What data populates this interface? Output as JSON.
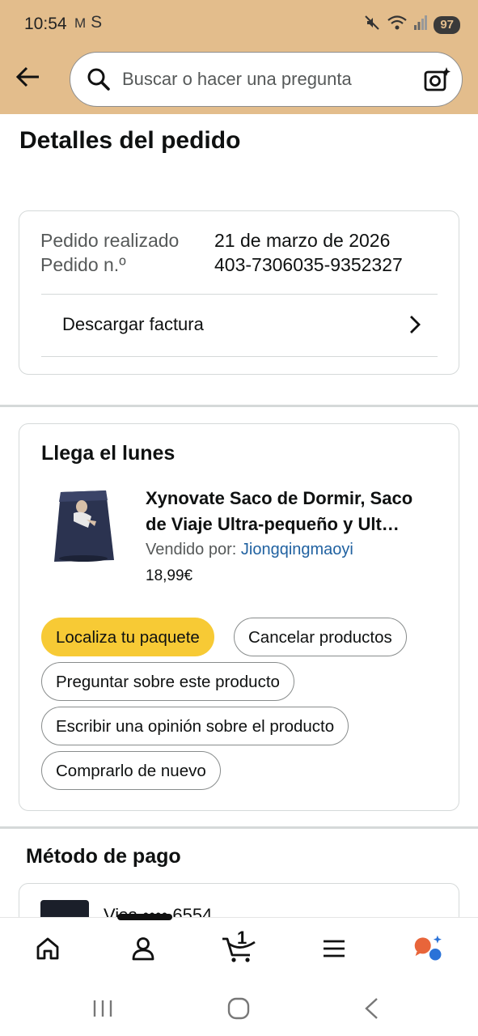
{
  "status_bar": {
    "time": "10:54",
    "notif_icons": [
      "M",
      "S"
    ],
    "battery": "97"
  },
  "search": {
    "placeholder": "Buscar o hacer una pregunta"
  },
  "page": {
    "title": "Detalles del pedido"
  },
  "order_info": {
    "placed_label": "Pedido realizado",
    "placed_value": "21 de marzo de 2026",
    "number_label": "Pedido n.º",
    "number_value": "403-7306035-9352327",
    "invoice_label": "Descargar factura"
  },
  "shipment": {
    "heading": "Llega el lunes",
    "product_title_line1": "Xynovate Saco de Dormir, Saco",
    "product_title_line2": "de Viaje Ultra-pequeño y Ult…",
    "sold_by_label": "Vendido por:",
    "seller": "Jiongqingmaoyi",
    "price": "18,99€",
    "buttons": {
      "track": "Localiza tu paquete",
      "cancel": "Cancelar productos",
      "ask": "Preguntar sobre este producto",
      "review": "Escribir una opinión sobre el producto",
      "buy_again": "Comprarlo de nuevo"
    }
  },
  "payment": {
    "heading": "Método de pago",
    "card_text": "Visa •••• 6554"
  },
  "bottom_nav": {
    "cart_count": "1"
  },
  "colors": {
    "header_bg": "#e3bd8c",
    "primary_button": "#f7ca35",
    "link": "#2162a1"
  }
}
